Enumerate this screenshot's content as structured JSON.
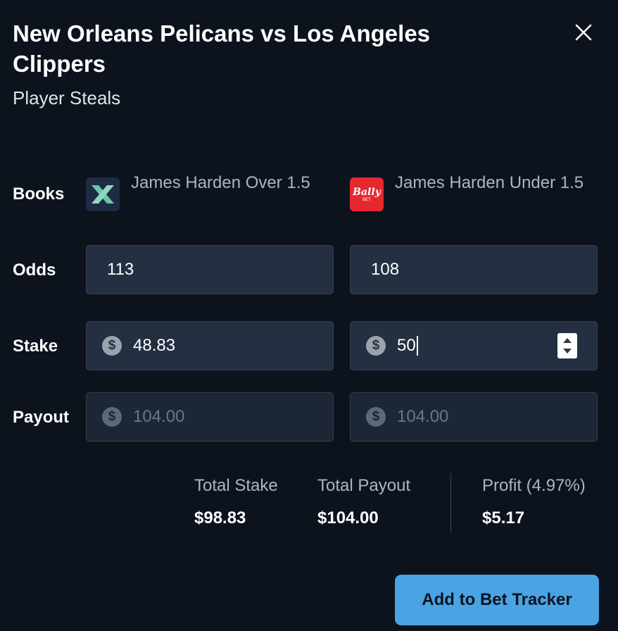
{
  "header": {
    "title": "New Orleans Pelicans vs Los Angeles Clippers",
    "subtitle": "Player Steals",
    "close_icon": "close-icon"
  },
  "labels": {
    "books": "Books",
    "odds": "Odds",
    "stake": "Stake",
    "payout": "Payout"
  },
  "bets": [
    {
      "book_icon": "x-book-logo-icon",
      "selection": "James Harden Over 1.5",
      "odds": "113",
      "stake": "48.83",
      "payout": "104.00"
    },
    {
      "book_icon": "bally-bet-logo-icon",
      "book_logo_text": "Bally",
      "book_logo_sub": "BET",
      "selection": "James Harden Under 1.5",
      "odds": "108",
      "stake": "50",
      "payout": "104.00"
    }
  ],
  "currency_symbol": "$",
  "summary": {
    "total_stake_label": "Total Stake",
    "total_stake": "$98.83",
    "total_payout_label": "Total Payout",
    "total_payout": "$104.00",
    "profit_label": "Profit (4.97%)",
    "profit": "$5.17"
  },
  "actions": {
    "add_to_tracker": "Add to Bet Tracker"
  },
  "colors": {
    "background": "#0c131d",
    "field": "#243042",
    "accent": "#4aa3e3",
    "bally_red": "#e4282e"
  }
}
